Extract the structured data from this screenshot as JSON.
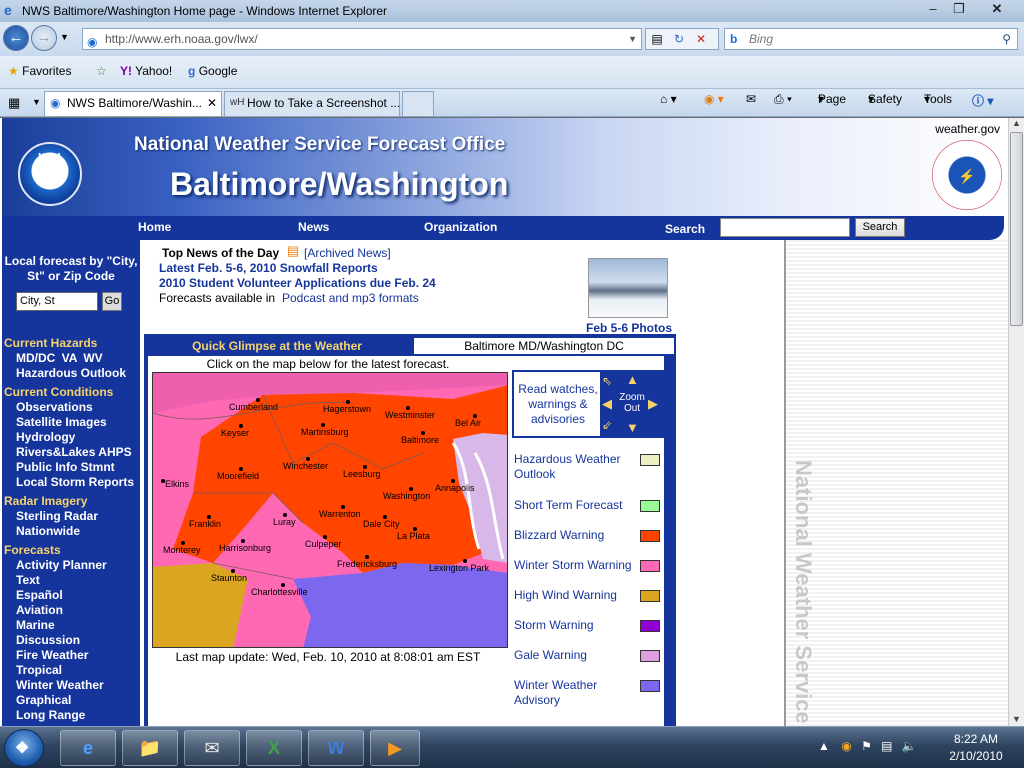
{
  "window": {
    "title": "NWS Baltimore/Washington Home page - Windows Internet Explorer"
  },
  "address": {
    "url": "http://www.erh.noaa.gov/lwx/",
    "search_placeholder": "Bing"
  },
  "favorites": {
    "label": "Favorites",
    "items": [
      "Yahoo!",
      "Google"
    ]
  },
  "tabs": [
    {
      "label": "NWS Baltimore/Washin...",
      "active": true
    },
    {
      "label": "How to Take a Screenshot ...",
      "active": false
    }
  ],
  "commandbar": {
    "page": "Page",
    "safety": "Safety",
    "tools": "Tools"
  },
  "banner": {
    "top_right": "weather.gov",
    "title_line1": "National Weather Service Forecast Office",
    "title_line2": "Baltimore/Washington",
    "noaa": "NOAA"
  },
  "nav": {
    "home": "Home",
    "news": "News",
    "organization": "Organization",
    "search_label": "Search",
    "search_button": "Search"
  },
  "sidebar": {
    "local_title": "Local forecast by \"City, St\" or Zip Code",
    "city_placeholder": "City, St",
    "go": "Go",
    "sections": [
      {
        "title": "Current Hazards",
        "items": [
          "MD/DC  VA   WV",
          "Hazardous Outlook"
        ]
      },
      {
        "title": "Current Conditions",
        "items": [
          "Observations",
          "Satellite Images",
          "Hydrology",
          "Rivers&Lakes AHPS",
          "Public Info Stmnt",
          "Local Storm Reports"
        ]
      },
      {
        "title": "Radar Imagery",
        "items": [
          "Sterling Radar",
          "Nationwide"
        ]
      },
      {
        "title": "Forecasts",
        "items": [
          "Activity Planner",
          "Text",
          "Español",
          "Aviation",
          "Marine",
          "Discussion",
          "Fire Weather",
          "Tropical",
          "Winter Weather",
          "Graphical",
          "Long Range"
        ]
      }
    ]
  },
  "news": {
    "title": "Top News of the Day",
    "archived": "[Archived News]",
    "item1": "Latest Feb. 5-6, 2010 Snowfall Reports",
    "item2": "2010 Student Volunteer Applications due Feb. 24",
    "item3_prefix": "Forecasts available in",
    "item3_link": "Podcast and mp3 formats",
    "photo_caption": "Feb 5-6 Photos"
  },
  "glimpse": {
    "tab1": "Quick Glimpse at the Weather",
    "tab2": "Baltimore MD/Washington DC",
    "instruction": "Click on the map below for the latest forecast.",
    "last_update": "Last map update: Wed, Feb. 10, 2010 at 8:08:01 am EST",
    "zoom_out": "Zoom Out",
    "legend_intro": "Read watches, warnings & advisories",
    "legend": [
      {
        "label": "Hazardous Weather Outlook",
        "color": "#eeeec0"
      },
      {
        "label": "Short Term Forecast",
        "color": "#98fb98"
      },
      {
        "label": "Blizzard Warning",
        "color": "#ff4500"
      },
      {
        "label": "Winter Storm Warning",
        "color": "#ff69b4"
      },
      {
        "label": "High Wind Warning",
        "color": "#daa520"
      },
      {
        "label": "Storm Warning",
        "color": "#9400d3"
      },
      {
        "label": "Gale Warning",
        "color": "#dda0dd"
      },
      {
        "label": "Winter Weather Advisory",
        "color": "#7b68ee"
      }
    ],
    "cities": [
      "Cumberland",
      "Hagerstown",
      "Westminster",
      "Bel Air",
      "Keyser",
      "Martinsburg",
      "Baltimore",
      "Moorefield",
      "Winchester",
      "Leesburg",
      "Elkins",
      "Washington",
      "Annapolis",
      "Franklin",
      "Luray",
      "Warrenton",
      "Dale City",
      "Monterey",
      "Harrisonburg",
      "Culpeper",
      "La Plata",
      "Fredericksburg",
      "Lexington Park",
      "Staunton",
      "Charlottesville"
    ]
  },
  "sidebar_right": {
    "vertical_text": "National Weather Service - Sinc"
  },
  "taskbar": {
    "time": "8:22 AM",
    "date": "2/10/2010"
  }
}
